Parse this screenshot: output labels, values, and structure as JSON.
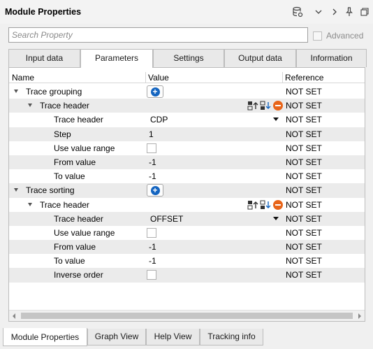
{
  "window": {
    "title": "Module Properties"
  },
  "toolbar_icons": [
    "database-gear-icon",
    "chevron-down-icon",
    "chevron-right-icon",
    "pin-icon",
    "restore-window-icon"
  ],
  "search": {
    "placeholder": "Search Property",
    "value": ""
  },
  "advanced": {
    "label": "Advanced",
    "checked": false
  },
  "tabs": [
    {
      "label": "Input data",
      "active": false
    },
    {
      "label": "Parameters",
      "active": true
    },
    {
      "label": "Settings",
      "active": false
    },
    {
      "label": "Output data",
      "active": false
    },
    {
      "label": "Information",
      "active": false
    }
  ],
  "columns": {
    "name": "Name",
    "value": "Value",
    "reference": "Reference"
  },
  "rows": [
    {
      "name": "Trace grouping",
      "level": 0,
      "expanded": true,
      "value": "",
      "ref": "NOT SET",
      "widget": "plus-button"
    },
    {
      "name": "Trace header",
      "level": 1,
      "expanded": true,
      "value": "",
      "ref": "NOT SET",
      "widget": "action-icons"
    },
    {
      "name": "Trace header",
      "level": 2,
      "value": "CDP",
      "ref": "NOT SET",
      "widget": "dropdown"
    },
    {
      "name": "Step",
      "level": 2,
      "value": "1",
      "ref": "NOT SET",
      "widget": "text"
    },
    {
      "name": "Use value range",
      "level": 2,
      "value": "",
      "ref": "NOT SET",
      "widget": "checkbox"
    },
    {
      "name": "From value",
      "level": 2,
      "value": "-1",
      "ref": "NOT SET",
      "widget": "text"
    },
    {
      "name": "To value",
      "level": 2,
      "value": "-1",
      "ref": "NOT SET",
      "widget": "text"
    },
    {
      "name": "Trace sorting",
      "level": 0,
      "expanded": true,
      "value": "",
      "ref": "NOT SET",
      "widget": "plus-button"
    },
    {
      "name": "Trace header",
      "level": 1,
      "expanded": true,
      "value": "",
      "ref": "NOT SET",
      "widget": "action-icons"
    },
    {
      "name": "Trace header",
      "level": 2,
      "value": "OFFSET",
      "ref": "NOT SET",
      "widget": "dropdown"
    },
    {
      "name": "Use value range",
      "level": 2,
      "value": "",
      "ref": "NOT SET",
      "widget": "checkbox"
    },
    {
      "name": "From value",
      "level": 2,
      "value": "-1",
      "ref": "NOT SET",
      "widget": "text"
    },
    {
      "name": "To value",
      "level": 2,
      "value": "-1",
      "ref": "NOT SET",
      "widget": "text"
    },
    {
      "name": "Inverse order",
      "level": 2,
      "value": "",
      "ref": "NOT SET",
      "widget": "checkbox"
    }
  ],
  "row_icons": [
    "move-up-icon",
    "move-down-icon",
    "remove-icon"
  ],
  "bottom_tabs": [
    {
      "label": "Module Properties",
      "active": true
    },
    {
      "label": "Graph View",
      "active": false
    },
    {
      "label": "Help View",
      "active": false
    },
    {
      "label": "Tracking info",
      "active": false
    }
  ],
  "colors": {
    "accent": "#1565c0",
    "remove": "#e8651a",
    "row_alt": "#ebebeb"
  }
}
